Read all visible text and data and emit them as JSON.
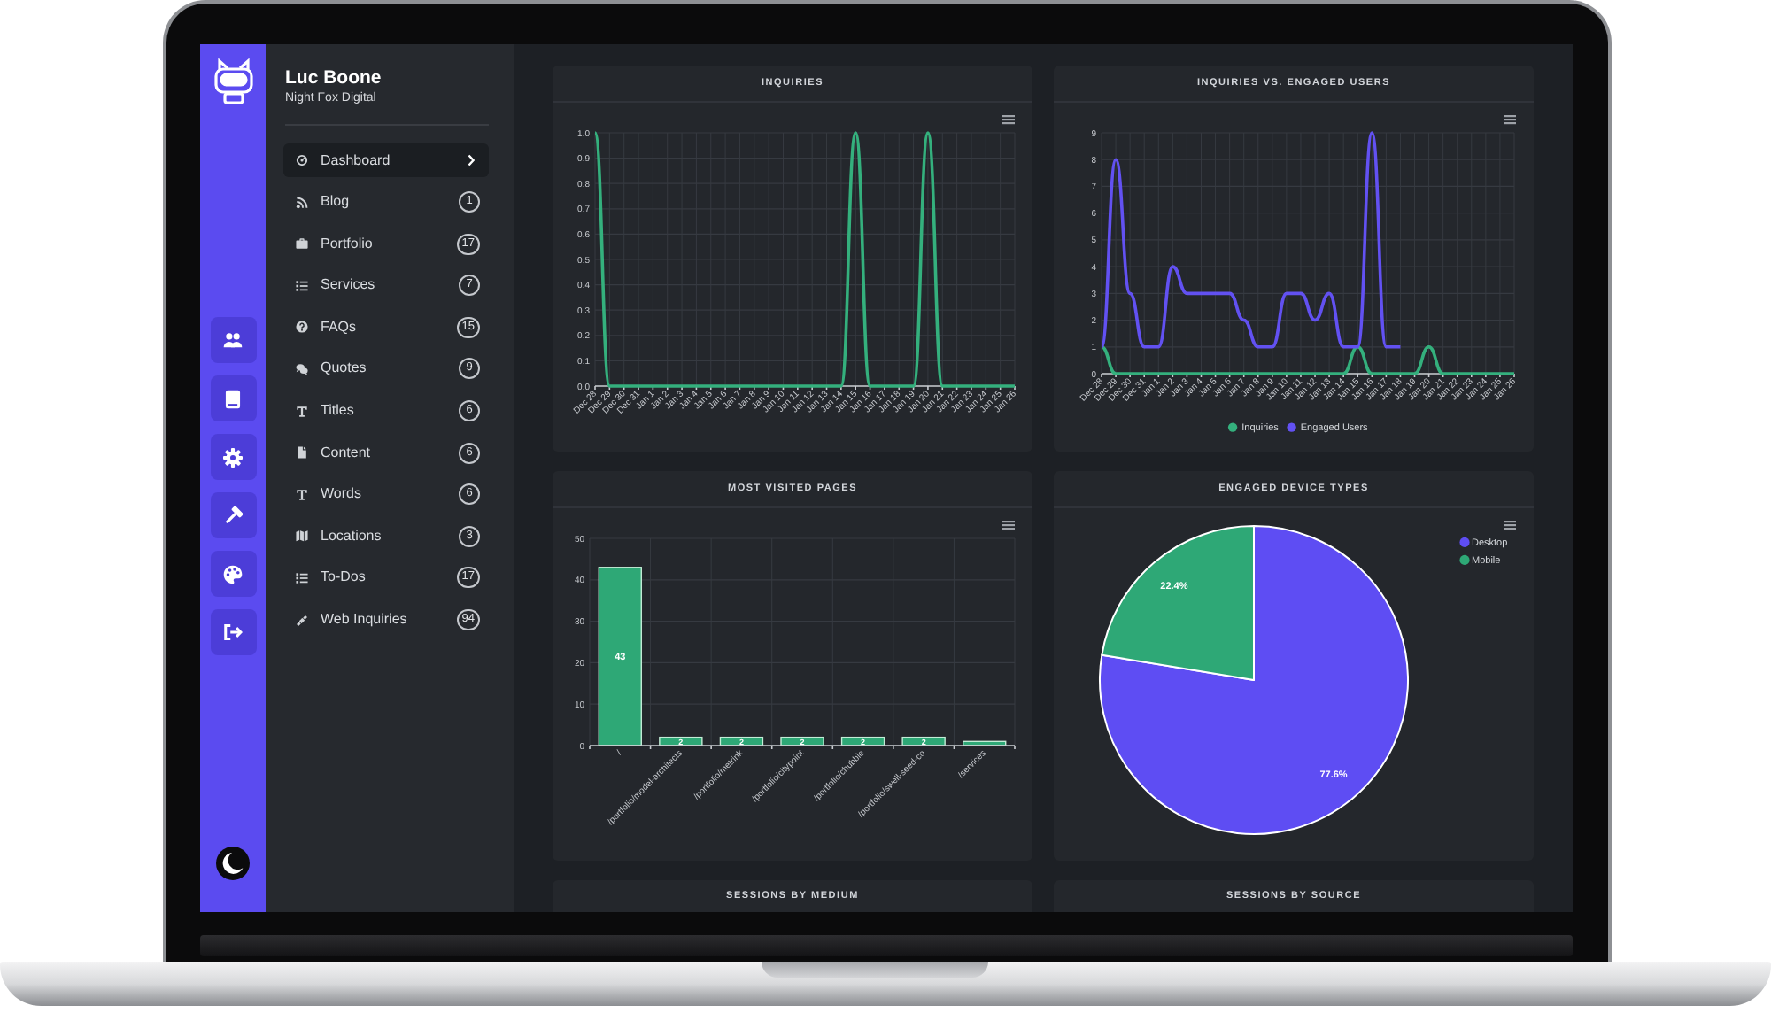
{
  "user": {
    "name": "Luc Boone",
    "company": "Night Fox Digital"
  },
  "menu": [
    {
      "label": "Dashboard",
      "selected": true
    },
    {
      "label": "Blog",
      "count": "1",
      "selected": false
    },
    {
      "label": "Portfolio",
      "count": "17",
      "selected": false
    },
    {
      "label": "Services",
      "count": "7",
      "selected": false
    },
    {
      "label": "FAQs",
      "count": "15",
      "selected": false
    },
    {
      "label": "Quotes",
      "count": "9",
      "selected": false
    },
    {
      "label": "Titles",
      "count": "6",
      "selected": false
    },
    {
      "label": "Content",
      "count": "6",
      "selected": false
    },
    {
      "label": "Words",
      "count": "6",
      "selected": false
    },
    {
      "label": "Locations",
      "count": "3",
      "selected": false
    },
    {
      "label": "To-Dos",
      "count": "17",
      "selected": false
    },
    {
      "label": "Web Inquiries",
      "count": "94",
      "selected": false
    }
  ],
  "charts": [
    {
      "chart_data": {
        "type": "line",
        "title": "INQUIRIES",
        "categories": [
          "Dec 28",
          "Dec 29",
          "Dec 30",
          "Dec 31",
          "Jan 1",
          "Jan 2",
          "Jan 3",
          "Jan 4",
          "Jan 5",
          "Jan 6",
          "Jan 7",
          "Jan 8",
          "Jan 9",
          "Jan 10",
          "Jan 11",
          "Jan 12",
          "Jan 13",
          "Jan 14",
          "Jan 15",
          "Jan 16",
          "Jan 17",
          "Jan 18",
          "Jan 19",
          "Jan 20",
          "Jan 21",
          "Jan 22",
          "Jan 23",
          "Jan 24",
          "Jan 25",
          "Jan 26"
        ],
        "series": [
          {
            "color": "#34b07d",
            "values": [
              1,
              0,
              0,
              0,
              0,
              0,
              0,
              0,
              0,
              0,
              0,
              0,
              0,
              0,
              0,
              0,
              0,
              0,
              1,
              0,
              0,
              0,
              0,
              1,
              0,
              0,
              0,
              0,
              0,
              0
            ]
          }
        ],
        "ylim": [
          0,
          1
        ],
        "yticks": [
          {
            "value": 0,
            "label": "0.0"
          },
          {
            "value": 0.1,
            "label": "0.1"
          },
          {
            "value": 0.2,
            "label": "0.2"
          },
          {
            "value": 0.3,
            "label": "0.3"
          },
          {
            "value": 0.4,
            "label": "0.4"
          },
          {
            "value": 0.5,
            "label": "0.5"
          },
          {
            "value": 0.6,
            "label": "0.6"
          },
          {
            "value": 0.7,
            "label": "0.7"
          },
          {
            "value": 0.8,
            "label": "0.8"
          },
          {
            "value": 0.9,
            "label": "0.9"
          },
          {
            "value": 1,
            "label": "1.0"
          }
        ],
        "grid": true
      }
    },
    {
      "chart_data": {
        "type": "line",
        "title": "INQUIRIES VS. ENGAGED USERS",
        "categories": [
          "Dec 28",
          "Dec 29",
          "Dec 30",
          "Dec 31",
          "Jan 1",
          "Jan 2",
          "Jan 3",
          "Jan 4",
          "Jan 5",
          "Jan 6",
          "Jan 7",
          "Jan 8",
          "Jan 9",
          "Jan 10",
          "Jan 11",
          "Jan 12",
          "Jan 13",
          "Jan 14",
          "Jan 15",
          "Jan 16",
          "Jan 17",
          "Jan 18",
          "Jan 19",
          "Jan 20",
          "Jan 21",
          "Jan 22",
          "Jan 23",
          "Jan 24",
          "Jan 25",
          "Jan 26"
        ],
        "series": [
          {
            "name": "Inquiries",
            "color": "#34b07d",
            "values": [
              1,
              0,
              0,
              0,
              0,
              0,
              0,
              0,
              0,
              0,
              0,
              0,
              0,
              0,
              0,
              0,
              0,
              0,
              1,
              0,
              0,
              0,
              0,
              1,
              0,
              0,
              0,
              0,
              0,
              0
            ]
          },
          {
            "name": "Engaged Users",
            "color": "#6251f2",
            "values": [
              1,
              8,
              3,
              1,
              1,
              4,
              3,
              3,
              3,
              3,
              2,
              1,
              1,
              3,
              3,
              2,
              3,
              1,
              1,
              9,
              1,
              1,
              null,
              null,
              null,
              null,
              null,
              null,
              null,
              null
            ]
          }
        ],
        "ylim": [
          0,
          9
        ],
        "yticks": [
          {
            "value": 0,
            "label": "0"
          },
          {
            "value": 1,
            "label": "1"
          },
          {
            "value": 2,
            "label": "2"
          },
          {
            "value": 3,
            "label": "3"
          },
          {
            "value": 4,
            "label": "4"
          },
          {
            "value": 5,
            "label": "5"
          },
          {
            "value": 6,
            "label": "6"
          },
          {
            "value": 7,
            "label": "7"
          },
          {
            "value": 8,
            "label": "8"
          },
          {
            "value": 9,
            "label": "9"
          }
        ],
        "grid": true,
        "legend": true
      }
    },
    {
      "chart_data": {
        "type": "bar",
        "title": "MOST VISITED PAGES",
        "categories": [
          "/",
          "/portfolio/model-architects",
          "/portfolio/metrink",
          "/portfolio/citypoint",
          "/portfolio/chubbie",
          "/portfolio/swell-seed-co",
          "/services"
        ],
        "series": [
          {
            "color": "#2ea876",
            "values": [
              43,
              2,
              2,
              2,
              2,
              2,
              1
            ]
          }
        ],
        "ylim": [
          0,
          50
        ],
        "yticks": [
          {
            "value": 0,
            "label": "0"
          },
          {
            "value": 10,
            "label": "10"
          },
          {
            "value": 20,
            "label": "20"
          },
          {
            "value": 30,
            "label": "30"
          },
          {
            "value": 40,
            "label": "40"
          },
          {
            "value": 50,
            "label": "50"
          }
        ],
        "grid": true,
        "value_labels": [
          "43",
          "2",
          "2",
          "2",
          "2",
          "2",
          null
        ]
      }
    },
    {
      "chart_data": {
        "type": "pie",
        "title": "ENGAGED DEVICE TYPES",
        "categories": [
          "Desktop",
          "Mobile"
        ],
        "series": [
          {
            "values": [
              77.6,
              22.4
            ]
          }
        ],
        "colors": [
          "#5e4df3",
          "#2ea876"
        ],
        "value_labels": [
          "77.6%",
          "22.4%"
        ],
        "legend": true
      }
    }
  ],
  "partial_cards": [
    {
      "title": "SESSIONS BY MEDIUM"
    },
    {
      "title": "SESSIONS BY SOURCE"
    }
  ]
}
